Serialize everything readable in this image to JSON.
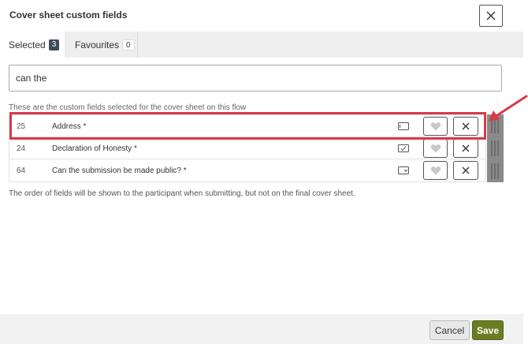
{
  "dialog": {
    "title": "Cover sheet custom fields"
  },
  "tabs": [
    {
      "label": "Selected",
      "count": "3"
    },
    {
      "label": "Favourites",
      "count": "0"
    }
  ],
  "search": {
    "value": "can the",
    "placeholder": ""
  },
  "info_text": "These are the custom fields selected for the cover sheet on this flow",
  "fields": [
    {
      "id": "25",
      "name": "Address *",
      "type_icon": "text-field-icon"
    },
    {
      "id": "24",
      "name": "Declaration of Honesty *",
      "type_icon": "checkbox-field-icon"
    },
    {
      "id": "64",
      "name": "Can the submission be made public? *",
      "type_icon": "dropdown-field-icon"
    }
  ],
  "footer_note": "The order of fields will be shown to the participant when submitting, but not on the final cover sheet.",
  "buttons": {
    "cancel": "Cancel",
    "save": "Save"
  },
  "colors": {
    "highlight": "#d83a4a",
    "save": "#6b7c23",
    "badge": "#3d4b5c",
    "drag_handle": "#8a8a8a"
  }
}
